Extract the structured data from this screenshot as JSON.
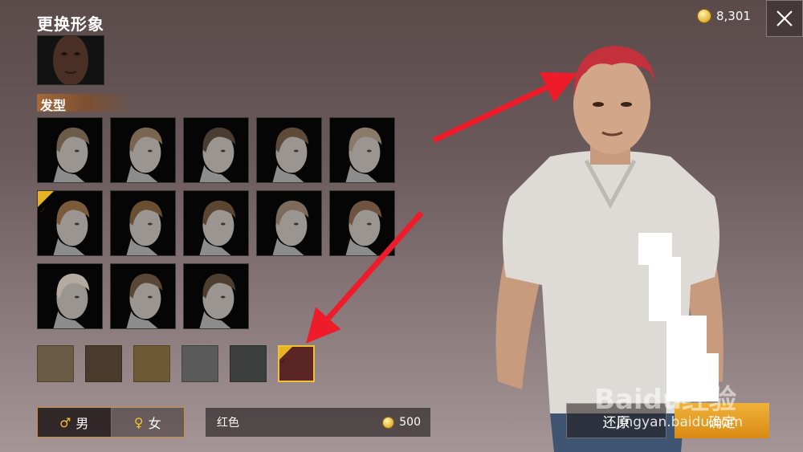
{
  "header": {
    "title": "更换形象",
    "coin_balance": "8,301"
  },
  "section": {
    "hair_label": "发型"
  },
  "hair_styles": [
    {
      "id": "style-1",
      "selected": false
    },
    {
      "id": "style-2",
      "selected": false
    },
    {
      "id": "style-3",
      "selected": false
    },
    {
      "id": "style-4",
      "selected": false
    },
    {
      "id": "style-5",
      "selected": false
    },
    {
      "id": "style-6",
      "selected": true
    },
    {
      "id": "style-7",
      "selected": false
    },
    {
      "id": "style-8",
      "selected": false
    },
    {
      "id": "style-9",
      "selected": false
    },
    {
      "id": "style-10",
      "selected": false
    },
    {
      "id": "style-11",
      "selected": false
    },
    {
      "id": "style-12",
      "selected": false
    },
    {
      "id": "style-13",
      "selected": false
    }
  ],
  "hair_colors": [
    {
      "hex": "#6b5a44",
      "selected": false
    },
    {
      "hex": "#4a3a2c",
      "selected": false
    },
    {
      "hex": "#6e5a35",
      "selected": false
    },
    {
      "hex": "#5b5a5a",
      "selected": false
    },
    {
      "hex": "#3c3f3e",
      "selected": false
    },
    {
      "hex": "#5c2525",
      "selected": true
    }
  ],
  "gender": {
    "male_symbol": "♂",
    "male_label": "男",
    "female_symbol": "♀",
    "female_label": "女"
  },
  "selected_color": {
    "name": "红色",
    "price": "500"
  },
  "buttons": {
    "reset": "还原",
    "confirm": "确定"
  },
  "watermark": {
    "brand": "Baidu经验",
    "url": "jingyan.baidu.com"
  },
  "colors": {
    "accent": "#e6b325",
    "confirm": "#e09a20"
  }
}
